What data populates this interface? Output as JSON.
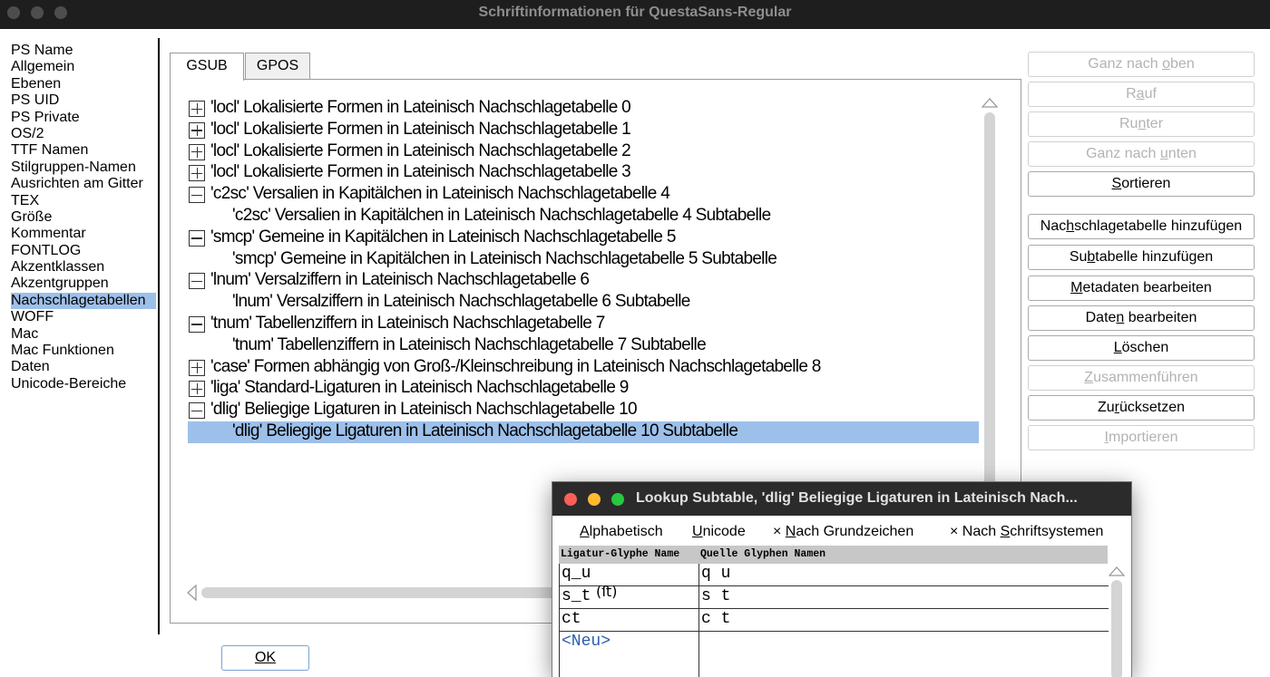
{
  "window": {
    "title": "Schriftinformationen für QuestaSans-Regular"
  },
  "sidebar": {
    "items": [
      "PS Name",
      "Allgemein",
      "Ebenen",
      "PS UID",
      "PS Private",
      "OS/2",
      "TTF Namen",
      "Stilgruppen-Namen",
      "Ausrichten am Gitter",
      "TEX",
      "Größe",
      "Kommentar",
      "FONTLOG",
      "Akzentklassen",
      "Akzentgruppen",
      "Nachschlagetabellen",
      "WOFF",
      "Mac",
      "Mac Funktionen",
      "Daten",
      "Unicode-Bereiche"
    ],
    "selected": "Nachschlagetabellen"
  },
  "tabs": [
    {
      "label": "GSUB",
      "active": true
    },
    {
      "label": "GPOS",
      "active": false
    }
  ],
  "lookups": [
    {
      "text": "'locl' Lokalisierte Formen in Lateinisch Nachschlagetabelle 0",
      "kind": "parent",
      "expander": "plus"
    },
    {
      "text": "'locl' Lokalisierte Formen in Lateinisch Nachschlagetabelle 1",
      "kind": "parent",
      "expander": "plus"
    },
    {
      "text": "'locl' Lokalisierte Formen in Lateinisch Nachschlagetabelle 2",
      "kind": "parent",
      "expander": "plus"
    },
    {
      "text": "'locl' Lokalisierte Formen in Lateinisch Nachschlagetabelle 3",
      "kind": "parent",
      "expander": "plus"
    },
    {
      "text": "'c2sc' Versalien in Kapitälchen in Lateinisch Nachschlagetabelle 4",
      "kind": "parent",
      "expander": "minus"
    },
    {
      "text": "'c2sc' Versalien in Kapitälchen in Lateinisch Nachschlagetabelle 4 Subtabelle",
      "kind": "child"
    },
    {
      "text": "'smcp' Gemeine in Kapitälchen in Lateinisch Nachschlagetabelle 5",
      "kind": "parent",
      "expander": "minus"
    },
    {
      "text": "'smcp' Gemeine in Kapitälchen in Lateinisch Nachschlagetabelle 5 Subtabelle",
      "kind": "child"
    },
    {
      "text": "'lnum' Versalziffern in Lateinisch Nachschlagetabelle 6",
      "kind": "parent",
      "expander": "minus"
    },
    {
      "text": "'lnum' Versalziffern in Lateinisch Nachschlagetabelle 6 Subtabelle",
      "kind": "child"
    },
    {
      "text": "'tnum' Tabellenziffern in Lateinisch Nachschlagetabelle 7",
      "kind": "parent",
      "expander": "minus"
    },
    {
      "text": "'tnum' Tabellenziffern in Lateinisch Nachschlagetabelle 7 Subtabelle",
      "kind": "child"
    },
    {
      "text": "'case' Formen abhängig von Groß-/Kleinschreibung in Lateinisch Nachschlagetabelle 8",
      "kind": "parent",
      "expander": "plus"
    },
    {
      "text": "'liga' Standard-Ligaturen in Lateinisch Nachschlagetabelle 9",
      "kind": "parent",
      "expander": "plus"
    },
    {
      "text": "'dlig' Beliegige Ligaturen in Lateinisch Nachschlagetabelle 10",
      "kind": "parent",
      "expander": "minus"
    },
    {
      "text": "'dlig' Beliegige Ligaturen in Lateinisch Nachschlagetabelle 10 Subtabelle",
      "kind": "child",
      "selected": true
    }
  ],
  "buttons": [
    {
      "label": "Ganz nach oben",
      "mnemonic": "o",
      "enabled": false
    },
    {
      "label": "Rauf",
      "mnemonic": "a",
      "enabled": false
    },
    {
      "label": "Runter",
      "mnemonic": "n",
      "enabled": false
    },
    {
      "label": "Ganz nach unten",
      "mnemonic": "u",
      "enabled": false
    },
    {
      "label": "Sortieren",
      "mnemonic": "S",
      "enabled": true
    },
    {
      "label": "Nachschlagetabelle hinzufügen",
      "mnemonic": "h",
      "enabled": true
    },
    {
      "label": "Subtabelle hinzufügen",
      "mnemonic": "b",
      "enabled": true
    },
    {
      "label": "Metadaten bearbeiten",
      "mnemonic": "M",
      "enabled": true
    },
    {
      "label": "Daten bearbeiten",
      "mnemonic": "n",
      "enabled": true
    },
    {
      "label": "Löschen",
      "mnemonic": "L",
      "enabled": true
    },
    {
      "label": "Zusammenführen",
      "mnemonic": "Z",
      "enabled": false
    },
    {
      "label": "Zurücksetzen",
      "mnemonic": "r",
      "enabled": true
    },
    {
      "label": "Importieren",
      "mnemonic": "I",
      "enabled": false
    }
  ],
  "ok_label": "OK",
  "dialog": {
    "title": "Lookup Subtable, 'dlig' Beliegige Ligaturen in Lateinisch Nach...",
    "options": [
      {
        "label": "Alphabetisch",
        "mnemonic": "A",
        "checked": false
      },
      {
        "label": "Unicode",
        "mnemonic": "U",
        "checked": false
      },
      {
        "label": "Nach Grundzeichen",
        "mnemonic": "N",
        "checked": true
      },
      {
        "label": "Nach Schriftsystemen",
        "mnemonic": "S",
        "checked": true
      }
    ],
    "columns": [
      "Ligatur-Glyphe Name",
      "Quelle Glyphen Namen"
    ],
    "rows": [
      {
        "ligature": "q_u",
        "sources": "q u"
      },
      {
        "ligature": "s_t",
        "glyph": "ﬅ",
        "sources": "s t"
      },
      {
        "ligature": "ct",
        "sources": "c t"
      }
    ],
    "new_row_label": "<Neu>",
    "check_mark": "×"
  },
  "colors": {
    "selection": "#9dc0ea",
    "titlebar": "#1e1e1e",
    "disabled_text": "#b3b3b3",
    "new_row_text": "#2a5db0"
  }
}
